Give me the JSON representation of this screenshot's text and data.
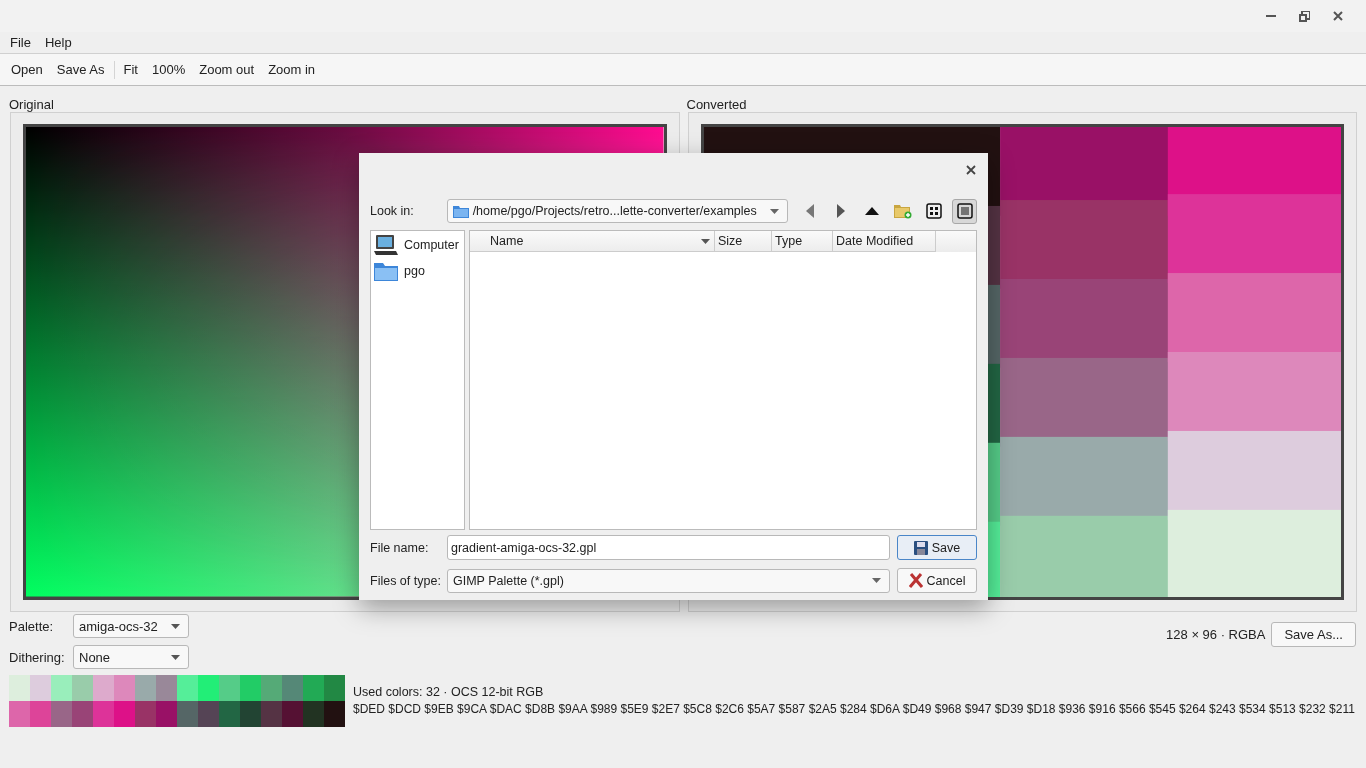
{
  "menu": [
    {
      "label": "File"
    },
    {
      "label": "Help"
    }
  ],
  "toolbar_groups": [
    {
      "items": [
        "Open",
        "Save As"
      ]
    },
    {
      "items": [
        "Fit",
        "100%",
        "Zoom out",
        "Zoom in"
      ]
    }
  ],
  "panels": [
    {
      "title": "Original",
      "kind": "picture"
    },
    {
      "title": "Converted",
      "kind": "picture"
    }
  ],
  "palette": {
    "label": "Palette:",
    "value": "amiga-ocs-32"
  },
  "dithering": {
    "label": "Dithering:",
    "value": "None"
  },
  "image_info": "128 × 96 · RGBA",
  "save_button": "Save As...",
  "swatches": [
    {
      "color": "#ddeedd"
    },
    {
      "color": "#ddccdd"
    },
    {
      "color": "#99eebb"
    },
    {
      "color": "#99ccaa"
    },
    {
      "color": "#ddaacc"
    },
    {
      "color": "#dd88bb"
    },
    {
      "color": "#99aaaa"
    },
    {
      "color": "#998899"
    },
    {
      "color": "#55ee99"
    },
    {
      "color": "#22ee77"
    },
    {
      "color": "#55cc88"
    },
    {
      "color": "#22cc66"
    },
    {
      "color": "#55aa77"
    },
    {
      "color": "#558877"
    },
    {
      "color": "#22aa55"
    },
    {
      "color": "#228844"
    },
    {
      "color": "#dd66aa"
    },
    {
      "color": "#dd4499"
    },
    {
      "color": "#996688"
    },
    {
      "color": "#994477"
    },
    {
      "color": "#dd3399"
    },
    {
      "color": "#dd1188"
    },
    {
      "color": "#993366"
    },
    {
      "color": "#991166"
    },
    {
      "color": "#556666"
    },
    {
      "color": "#554455"
    },
    {
      "color": "#226644"
    },
    {
      "color": "#224433"
    },
    {
      "color": "#553344"
    },
    {
      "color": "#551133"
    },
    {
      "color": "#223322"
    },
    {
      "color": "#221111"
    }
  ],
  "used_colors": "Used colors: 32 · OCS 12-bit RGB",
  "color_codes": "$DED $DCD $9EB $9CA $DAC $D8B $9AA $989 $5E9 $2E7 $5C8 $2C6 $5A7 $587 $2A5 $284 $D6A $D49 $968 $947 $D39 $D18 $936 $916 $566 $545 $264 $243 $534 $513 $232 $211",
  "dialog": {
    "look_in": {
      "label": "Look in:",
      "value": "/home/pgo/Projects/retro...lette-converter/examples"
    },
    "nav_buttons": [
      {
        "kind": "back"
      },
      {
        "kind": "forward"
      },
      {
        "kind": "up"
      },
      {
        "kind": "new-folder"
      },
      {
        "kind": "icon-view",
        "selected": false
      },
      {
        "kind": "detail-view",
        "selected": true
      }
    ],
    "places": [
      {
        "label": "Computer",
        "kind": "computer"
      },
      {
        "label": "pgo",
        "kind": "folder"
      }
    ],
    "columns": [
      {
        "label": "Name",
        "sorted": true
      },
      {
        "label": "Size",
        "sorted": false
      },
      {
        "label": "Type",
        "sorted": false
      },
      {
        "label": "Date Modified",
        "sorted": false
      }
    ],
    "file_name": {
      "label": "File name:",
      "value": "gradient-amiga-ocs-32.gpl"
    },
    "file_type": {
      "label": "Files of type:",
      "value": "GIMP Palette (*.gpl)"
    },
    "buttons": [
      {
        "label": "Save",
        "kind": "save",
        "default": true
      },
      {
        "label": "Cancel",
        "kind": "cancel",
        "default": false
      }
    ]
  }
}
